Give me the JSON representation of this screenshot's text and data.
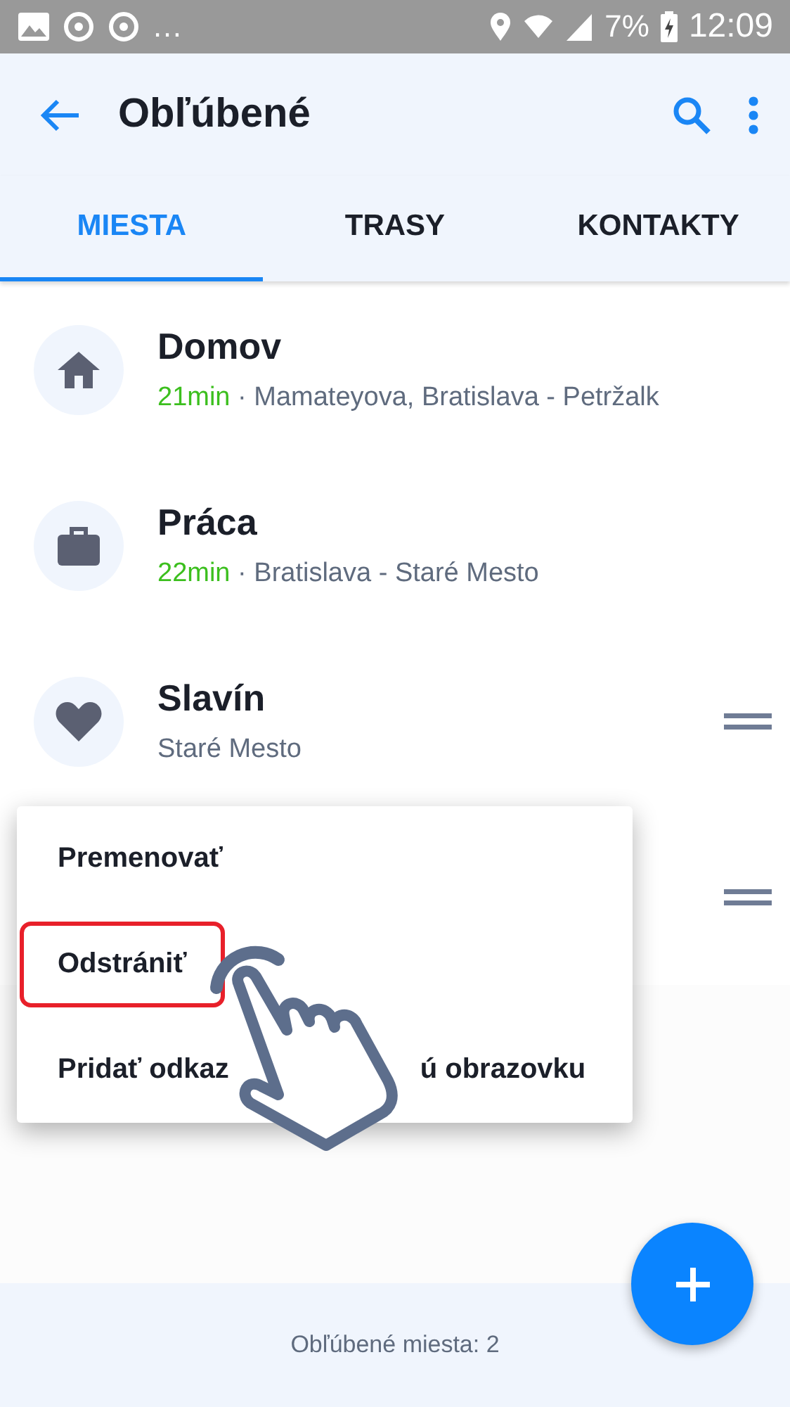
{
  "status_bar": {
    "overflow": "…",
    "battery": "7%",
    "time": "12:09"
  },
  "app_bar": {
    "title": "Obľúbené"
  },
  "tabs": [
    {
      "label": "MIESTA",
      "selected": true
    },
    {
      "label": "TRASY",
      "selected": false
    },
    {
      "label": "KONTAKTY",
      "selected": false
    }
  ],
  "places": [
    {
      "kind": "home",
      "name": "Domov",
      "duration": "21min",
      "separator": "·",
      "address": "Mamateyova, Bratislava - Petržalk",
      "draggable": false
    },
    {
      "kind": "work",
      "name": "Práca",
      "duration": "22min",
      "separator": "·",
      "address": "Bratislava - Staré Mesto",
      "draggable": false
    },
    {
      "kind": "favorite",
      "name": "Slavín",
      "address": "Staré Mesto",
      "draggable": true
    },
    {
      "draggable": true
    }
  ],
  "context_menu": {
    "items": [
      {
        "label": "Premenovať",
        "highlighted": false
      },
      {
        "label": "Odstrániť",
        "highlighted": true
      },
      {
        "label": "Pridať odkaz",
        "label_after": "ú obrazovku",
        "highlighted": false
      }
    ]
  },
  "footer": {
    "text": "Obľúbené miesta: 2"
  }
}
